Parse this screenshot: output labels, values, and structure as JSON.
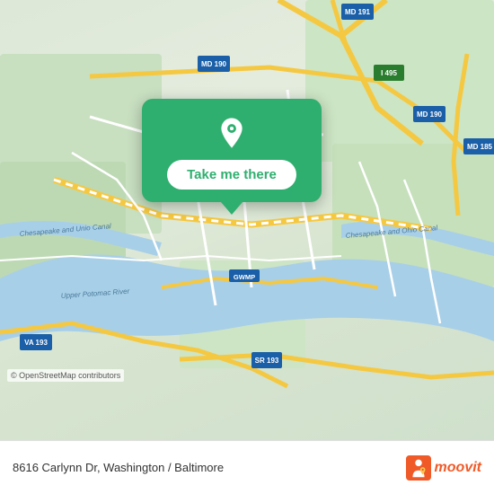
{
  "map": {
    "attribution": "© OpenStreetMap contributors",
    "center_address": "8616 Carlynn Dr, Washington / Baltimore"
  },
  "popup": {
    "button_label": "Take me there"
  },
  "bottom_bar": {
    "address": "8616 Carlynn Dr, Washington / Baltimore"
  },
  "moovit": {
    "logo_text": "moovit"
  },
  "road_labels": {
    "md191": "MD 191",
    "i495": "I 495",
    "md190_top": "MD 190",
    "md190_right": "MD 190",
    "md185": "MD 185",
    "va193": "VA 193",
    "sr193": "SR 193",
    "gwmp": "GWMP",
    "chesapeake_canal1": "Chesapeake and Union Canal",
    "chesapeake_canal2": "Chesapeake and Ohio Canal",
    "upper_potomac": "Upper Potomac River"
  }
}
